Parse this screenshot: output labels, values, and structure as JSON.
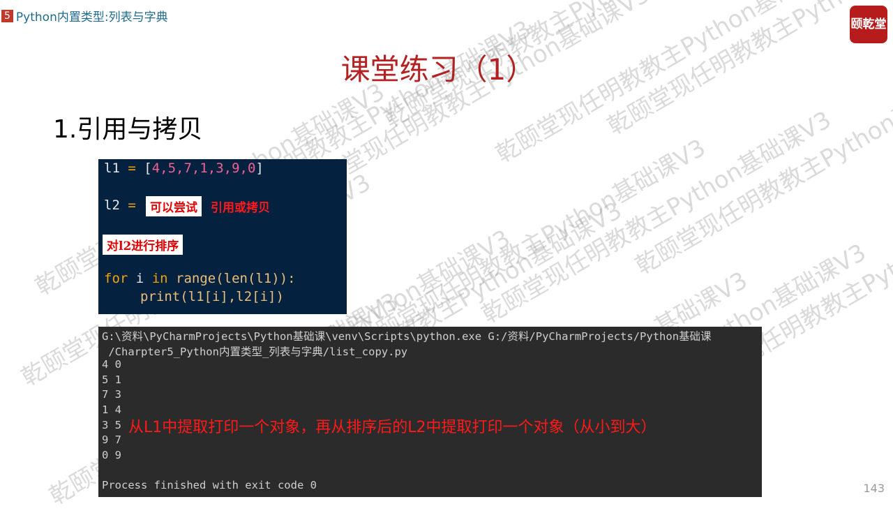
{
  "header": {
    "chapter_number": "5",
    "chapter_title": "Python内置类型:列表与字典",
    "logo_text": "颐乾堂"
  },
  "slide": {
    "title": "课堂练习（1）",
    "subtitle": "1.引用与拷贝",
    "page_number": "143"
  },
  "code": {
    "line1": {
      "var": "l1",
      "op": "=",
      "open": "[",
      "values": "4,5,7,1,3,9,0",
      "close": "]"
    },
    "line2": {
      "var": "l2",
      "op": "="
    },
    "note1_boxed": "可以尝试",
    "note1_rest": "引用或拷贝",
    "note2": "对l2进行排序",
    "line3": {
      "kw1": "for",
      "var": "i",
      "kw2": "in",
      "rest": "range(len(l1)):"
    },
    "line4": "print(l1[i],l2[i])"
  },
  "terminal": {
    "lines": [
      "G:\\资料\\PyCharmProjects\\Python基础课\\venv\\Scripts\\python.exe G:/资料/PyCharmProjects/Python基础课",
      " /Charpter5_Python内置类型_列表与字典/list_copy.py",
      "4 0",
      "5 1",
      "7 3",
      "1 4",
      "3 5",
      "9 7",
      "0 9",
      "",
      "Process finished with exit code 0"
    ],
    "annotation": "从L1中提取打印一个对象，再从排序后的L2中提取打印一个对象（从小到大）"
  },
  "watermark": "乾颐堂现任明教教主Python基础课V3",
  "colors": {
    "title": "#b22222",
    "code_bg": "#04213f",
    "terminal_bg": "#2b2b2b",
    "annotation": "#ff1a1a"
  }
}
